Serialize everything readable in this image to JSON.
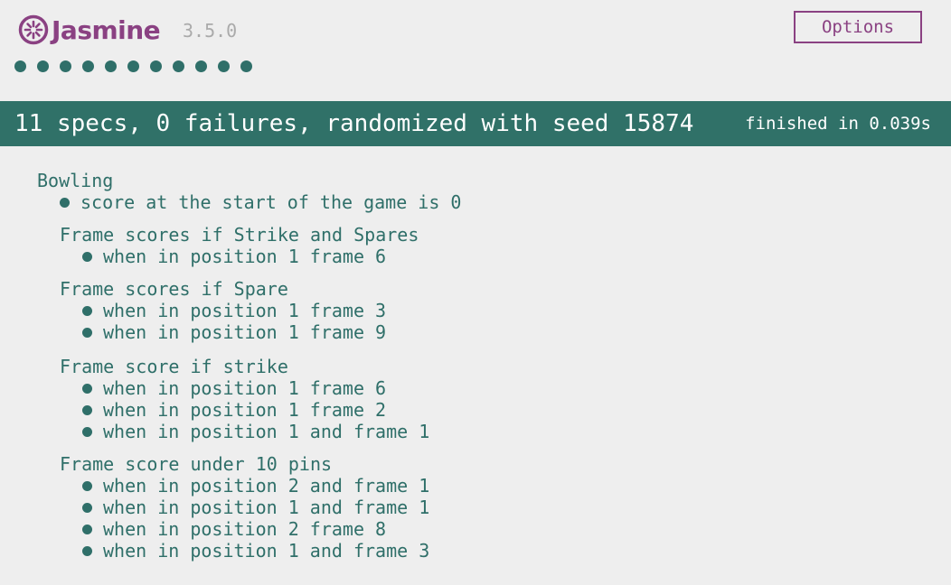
{
  "header": {
    "app_name": "Jasmine",
    "version": "3.5.0",
    "options_label": "Options",
    "spec_dot_count": 11
  },
  "summary": {
    "text": "11 specs, 0 failures, randomized with seed 15874",
    "duration": "finished in 0.039s"
  },
  "colors": {
    "brand": "#8a4182",
    "passed": "#307168",
    "background": "#eeeeee"
  },
  "results": {
    "suite": "Bowling",
    "top_spec": "score at the start of the game is 0",
    "groups": [
      {
        "title": "Frame scores if Strike and Spares",
        "specs": [
          "when in position 1 frame 6"
        ]
      },
      {
        "title": "Frame scores if Spare",
        "specs": [
          "when in position 1 frame 3",
          "when in position 1 frame 9"
        ]
      },
      {
        "title": "Frame score if strike",
        "specs": [
          "when in position 1 frame 6",
          "when in position 1 frame 2",
          "when in position 1 and frame 1"
        ]
      },
      {
        "title": "Frame score under 10 pins",
        "specs": [
          "when in position 2 and frame 1",
          "when in position 1 and frame 1",
          "when in position 2 frame 8",
          "when in position 1 and frame 3"
        ]
      }
    ]
  }
}
